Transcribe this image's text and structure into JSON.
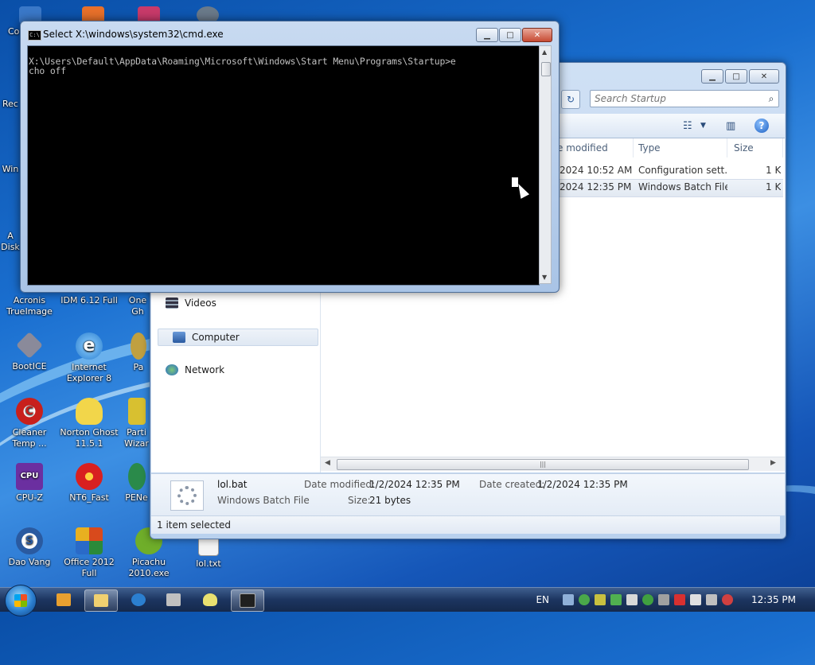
{
  "desktop": {
    "icons": [
      {
        "label": "Co",
        "color": "#3a78c8"
      },
      {
        "label": "Rec",
        "color": "#6a8cb0"
      },
      {
        "label": "Win",
        "color": "#3f7fc4"
      },
      {
        "label": "A Disk",
        "color": "#6a6a6a"
      },
      {
        "label": "Acronis TrueImage",
        "color": "#4a5a7a"
      },
      {
        "label": "IDM 6.12 Full",
        "color": "#3c8a3c"
      },
      {
        "label": "One Gh",
        "color": "#c48a2a"
      },
      {
        "label": "BootICE",
        "color": "#8a8a9a"
      },
      {
        "label": "Internet Explorer 8",
        "color": "#2b7fd0"
      },
      {
        "label": "Pa",
        "color": "#c0a040"
      },
      {
        "label": "Cleaner Temp ...",
        "color": "#c8201c"
      },
      {
        "label": "Norton Ghost 11.5.1",
        "color": "#f2d64a"
      },
      {
        "label": "Parti Wizar",
        "color": "#d8c030"
      },
      {
        "label": "CPU-Z",
        "color": "#6b2fa0"
      },
      {
        "label": "NT6_Fast",
        "color": "#d82020"
      },
      {
        "label": "PENe",
        "color": "#2a8a4a"
      },
      {
        "label": "Dao Vang",
        "color": "#2a5aa0"
      },
      {
        "label": "Office 2012 Full",
        "color": "#d84a1c"
      },
      {
        "label": "Picachu 2010.exe",
        "color": "#6fae2a"
      },
      {
        "label": "lol.txt",
        "color": "#f4f4f4"
      }
    ],
    "top_icon_colors": [
      "#3a6fc4",
      "#e8702a",
      "#c83a6a",
      "#6a7a8a"
    ]
  },
  "cmd": {
    "title": "Select X:\\windows\\system32\\cmd.exe",
    "icon_label": "C:\\",
    "console_text": "X:\\Users\\Default\\AppData\\Roaming\\Microsoft\\Windows\\Start Menu\\Programs\\Startup>e\ncho off",
    "min": "▁",
    "max": "□",
    "close": "✕"
  },
  "explorer": {
    "min": "▁",
    "max": "□",
    "close": "✕",
    "refresh": "↻",
    "search_placeholder": "Search Startup",
    "columns": {
      "date": "e modified",
      "type": "Type",
      "size": "Size"
    },
    "files": [
      {
        "date": "2024 10:52 AM",
        "type": "Configuration sett...",
        "size": "1 K"
      },
      {
        "date": "2024 12:35 PM",
        "type": "Windows Batch File",
        "size": "1 K"
      }
    ],
    "nav": {
      "videos": "Videos",
      "computer": "Computer",
      "network": "Network"
    },
    "details": {
      "name": "lol.bat",
      "type": "Windows Batch File",
      "date_modified_label": "Date modified:",
      "date_modified": "1/2/2024 12:35 PM",
      "date_created_label": "Date created:",
      "date_created": "1/2/2024 12:35 PM",
      "size_label": "Size:",
      "size": "21 bytes"
    },
    "status": "1 item selected"
  },
  "taskbar": {
    "language": "EN",
    "clock": "12:35 PM",
    "pinned_colors": [
      "#e8a030",
      "#f0d070",
      "#2b7fd0",
      "#c0c0c0",
      "#e8e070",
      "#202020"
    ],
    "tray_colors": [
      "#8fb0d8",
      "#4aa84a",
      "#c8c040",
      "#50b050",
      "#d8d8d8",
      "#40a040",
      "#a0a0a0",
      "#d83030",
      "#e0e0e0",
      "#c0c0c0",
      "#d04040"
    ]
  }
}
